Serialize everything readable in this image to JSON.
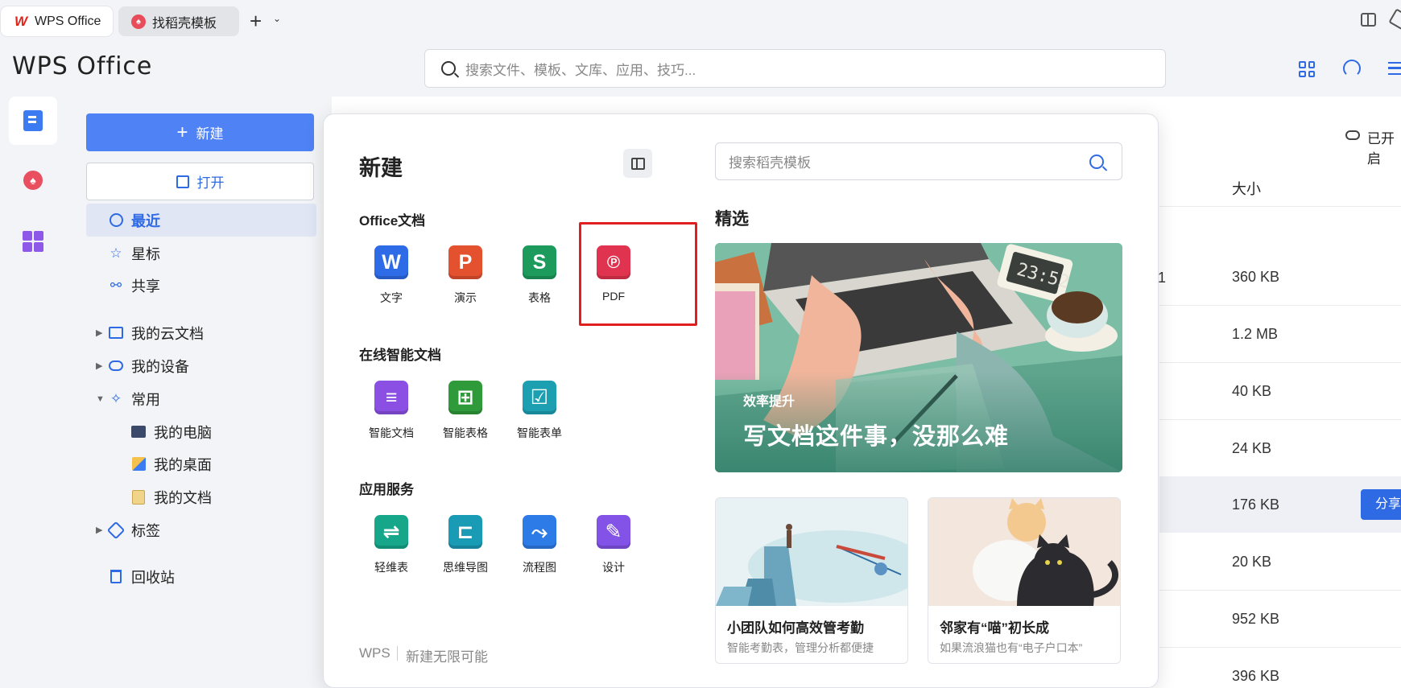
{
  "tabs": [
    {
      "label": "WPS Office",
      "icon": "wps-logo-icon"
    },
    {
      "label": "找稻壳模板",
      "icon": "daoke-icon"
    }
  ],
  "header": {
    "logo": "WPS Office",
    "search_placeholder": "搜索文件、模板、文库、应用、技巧..."
  },
  "sidebar": {
    "new_label": "新建",
    "open_label": "打开",
    "items": [
      {
        "label": "最近",
        "icon": "clock-icon"
      },
      {
        "label": "星标",
        "icon": "star-icon"
      },
      {
        "label": "共享",
        "icon": "share-icon"
      },
      {
        "label": "我的云文档",
        "icon": "folder-icon"
      },
      {
        "label": "我的设备",
        "icon": "cloud-upload-icon"
      },
      {
        "label": "常用",
        "icon": "pin-icon"
      },
      {
        "label": "我的电脑",
        "icon": "computer-icon"
      },
      {
        "label": "我的桌面",
        "icon": "desktop-icon"
      },
      {
        "label": "我的文档",
        "icon": "documents-icon"
      },
      {
        "label": "标签",
        "icon": "tag-icon"
      },
      {
        "label": "回收站",
        "icon": "trash-icon"
      }
    ]
  },
  "main": {
    "sync_label": "已开启",
    "size_header": "大小",
    "stray_digit": "1",
    "sizes": [
      "360 KB",
      "1.2 MB",
      "40 KB",
      "24 KB",
      "176 KB",
      "20 KB",
      "952 KB",
      "396 KB"
    ],
    "share_label": "分享"
  },
  "panel": {
    "title": "新建",
    "sections": [
      {
        "title": "Office文档",
        "apps": [
          {
            "label": "文字",
            "glyph": "W",
            "color": "#2e6be6"
          },
          {
            "label": "演示",
            "glyph": "P",
            "color": "#e4512f"
          },
          {
            "label": "表格",
            "glyph": "S",
            "color": "#1d9b5c"
          },
          {
            "label": "PDF",
            "glyph": "ᴘ",
            "color": "#e0334f"
          }
        ]
      },
      {
        "title": "在线智能文档",
        "apps": [
          {
            "label": "智能文档",
            "glyph": "≡",
            "color": "#8b4fe3"
          },
          {
            "label": "智能表格",
            "glyph": "⊞",
            "color": "#2f9a3a"
          },
          {
            "label": "智能表单",
            "glyph": "☑",
            "color": "#1d9fb2"
          }
        ]
      },
      {
        "title": "应用服务",
        "apps": [
          {
            "label": "轻维表",
            "glyph": "⇌",
            "color": "#16a68a"
          },
          {
            "label": "思维导图",
            "glyph": "⊏",
            "color": "#1a9bb5"
          },
          {
            "label": "流程图",
            "glyph": "⤳",
            "color": "#2d7be6"
          },
          {
            "label": "设计",
            "glyph": "✎",
            "color": "#8253e6"
          }
        ]
      }
    ],
    "footer_brand": "WPS",
    "footer_slogan": "新建无限可能",
    "template_search_placeholder": "搜索稻壳模板",
    "featured_title": "精选",
    "banner": {
      "tag": "效率提升",
      "headline": "写文档这件事，没那么难",
      "clock": "23:52"
    },
    "cards": [
      {
        "title": "小团队如何高效管考勤",
        "subtitle": "智能考勤表，管理分析都便捷"
      },
      {
        "title": "邻家有“喵”初长成",
        "subtitle": "如果流浪猫也有“电子户口本”"
      }
    ]
  }
}
